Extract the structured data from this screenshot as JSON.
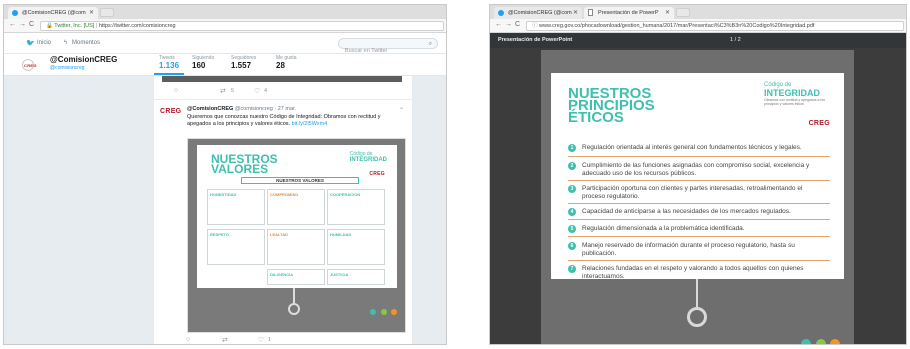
{
  "left_window": {
    "tab_active": "@ComisionCREG (@com",
    "url_secure": "Twitter, Inc. [US]",
    "url": "https://twitter.com/comisioncreg",
    "nav_home": "Inicio",
    "nav_moments": "Momentos",
    "search_placeholder": "Buscar en Twitter",
    "profile_name": "@ComisionCREG",
    "profile_handle": "@comisioncreg",
    "stats": [
      {
        "label": "Tweets",
        "value": "1.136"
      },
      {
        "label": "Siguiendo",
        "value": "160"
      },
      {
        "label": "Seguidores",
        "value": "1.557"
      },
      {
        "label": "Me gusta",
        "value": "28"
      }
    ],
    "prev_actions": {
      "retweets": "5",
      "likes": "4"
    },
    "tweet": {
      "author": "@ComisionCREG",
      "handle_date": "@comisioncreg · 27 mar.",
      "text": "Queremos que conozcas nuestro Código de Integridad: Obramos con rectitud y apegados a los principios y valores éticos.",
      "link": "bit.ly/2l5Wxm4",
      "actions": {
        "retweets": "",
        "likes": "1"
      }
    },
    "card": {
      "title_line1": "NUESTROS",
      "title_line2": "VALORES",
      "code_line1": "Código de",
      "code_line2": "INTEGRIDAD",
      "logo": "CREG",
      "banner": "NUESTROS VALORES",
      "values": [
        "HONESTIDAD",
        "COMPROMISO",
        "COOPERACIÓN",
        "RESPETO",
        "LEALTAD",
        "HUMILDAD",
        "DILIGENCIA",
        "JUSTICIA"
      ]
    }
  },
  "right_window": {
    "tab_active": "@ComisionCREG (@com",
    "tab_second": "Presentación de PowerP",
    "url": "www.creg.gov.co/phocadownload/gestion_humana/2017/mar/Presentaci%C3%B3n%20Codigo%20Integridad.pdf",
    "pdf_title": "Presentación de PowerPoint",
    "page_indicator": "1 / 2",
    "slide": {
      "title_line1": "NUESTROS",
      "title_line2": "PRINCIPIOS",
      "title_line3": "ÉTICOS",
      "code_line1": "Código de",
      "code_line2": "INTEGRIDAD",
      "code_sub": "Obramos con rectitud y apegados a los principios y valores éticos",
      "logo": "CREG",
      "principles": [
        "Regulación orientada al interés general con fundamentos técnicos y legales.",
        "Cumplimiento de las funciones asignadas con compromiso social, excelencia y adecuado uso de los recursos públicos.",
        "Participación oportuna con clientes y partes interesadas, retroalimentando el proceso regulatorio.",
        "Capacidad de anticiparse a las necesidades de los mercados regulados.",
        "Regulación dimensionada a la problemática identificada.",
        "Manejo reservado de información durante el proceso regulatorio, hasta su publicación.",
        "Relaciones fundadas en el respeto y valorando a todos aquellos con quienes interactuamos."
      ],
      "numbers": [
        "1",
        "2",
        "3",
        "4",
        "5",
        "6",
        "7"
      ]
    }
  },
  "colors": {
    "teal": "#3fbfae",
    "creg_red": "#b2182b",
    "twitter_blue": "#1da1f2",
    "orange": "#e4a16d"
  }
}
